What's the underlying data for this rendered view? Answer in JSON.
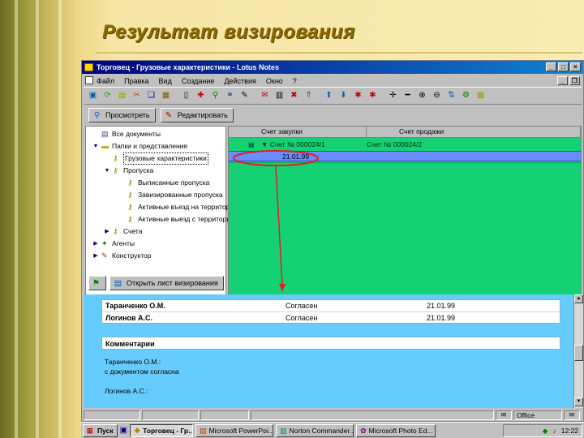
{
  "slide": {
    "title": "Результат визирования"
  },
  "window": {
    "title": "Торговец - Грузовые характеристики - Lotus Notes"
  },
  "menu": {
    "items": [
      "Файл",
      "Правка",
      "Вид",
      "Создание",
      "Действия",
      "Окно",
      "?"
    ]
  },
  "actions": {
    "view_label": "Просмотреть",
    "edit_label": "Редактировать"
  },
  "navigator": {
    "items": [
      {
        "label": "Все документы",
        "indent": 0,
        "twisty": "",
        "icon": "document-icon"
      },
      {
        "label": "Папки и представления",
        "indent": 0,
        "twisty": "▼",
        "icon": "folder-icon"
      },
      {
        "label": "Грузовые характеристики",
        "indent": 1,
        "twisty": "",
        "icon": "key-icon",
        "selected": true
      },
      {
        "label": "Пропуска",
        "indent": 1,
        "twisty": "▼",
        "icon": "key-icon"
      },
      {
        "label": "Выписанные пропуска",
        "indent": 2,
        "twisty": "",
        "icon": "key-icon"
      },
      {
        "label": "Завизированные пропуска",
        "indent": 2,
        "twisty": "",
        "icon": "key-icon"
      },
      {
        "label": "Активные въезд на территорию",
        "indent": 2,
        "twisty": "",
        "icon": "key-icon"
      },
      {
        "label": "Активные выезд с территории",
        "indent": 2,
        "twisty": "",
        "icon": "key-icon"
      },
      {
        "label": "Счета",
        "indent": 1,
        "twisty": "▶",
        "icon": "key-icon"
      },
      {
        "label": "Агенты",
        "indent": 0,
        "twisty": "▶",
        "icon": "agent-icon"
      },
      {
        "label": "Конструктор",
        "indent": 0,
        "twisty": "▶",
        "icon": "design-icon"
      }
    ]
  },
  "view": {
    "columns": [
      "Счет закупки",
      "Счет продажи"
    ],
    "rows": [
      {
        "c1": "▼ Счет № 000024/1",
        "c2": "Счет № 000024/2",
        "selected": false
      },
      {
        "c1": "21.01.99",
        "c2": "",
        "selected": true
      }
    ]
  },
  "document": {
    "open_sheet_label": "Открыть лист визирования",
    "visa_rows": [
      {
        "name": "Таранченко О.М.",
        "status": "Согласен",
        "date": "21.01.99"
      },
      {
        "name": "Логинов А.С.",
        "status": "Согласен",
        "date": "21.01.99"
      }
    ],
    "comments_header": "Комментарии",
    "comment_lines": [
      "Таранченко О.М.:",
      "с документом согласна",
      "Логинов А.С.:"
    ]
  },
  "statusbar": {
    "location": "Office"
  },
  "taskbar": {
    "start_label": "Пуск",
    "tasks": [
      {
        "label": "Торговец - Гр...",
        "icon": "lotus-icon",
        "active": true
      },
      {
        "label": "Microsoft PowerPoi...",
        "icon": "powerpoint-icon",
        "active": false
      },
      {
        "label": "Norton Commander...",
        "icon": "norton-icon",
        "active": false
      },
      {
        "label": "Microsoft Photo Ed...",
        "icon": "photo-editor-icon",
        "active": false
      }
    ],
    "clock": "12:22"
  },
  "colors": {
    "view_background": "#14d273",
    "document_background": "#66ccff",
    "selection": "#6a8cff",
    "annotation": "#e02020",
    "title_color": "#8a6a00"
  }
}
